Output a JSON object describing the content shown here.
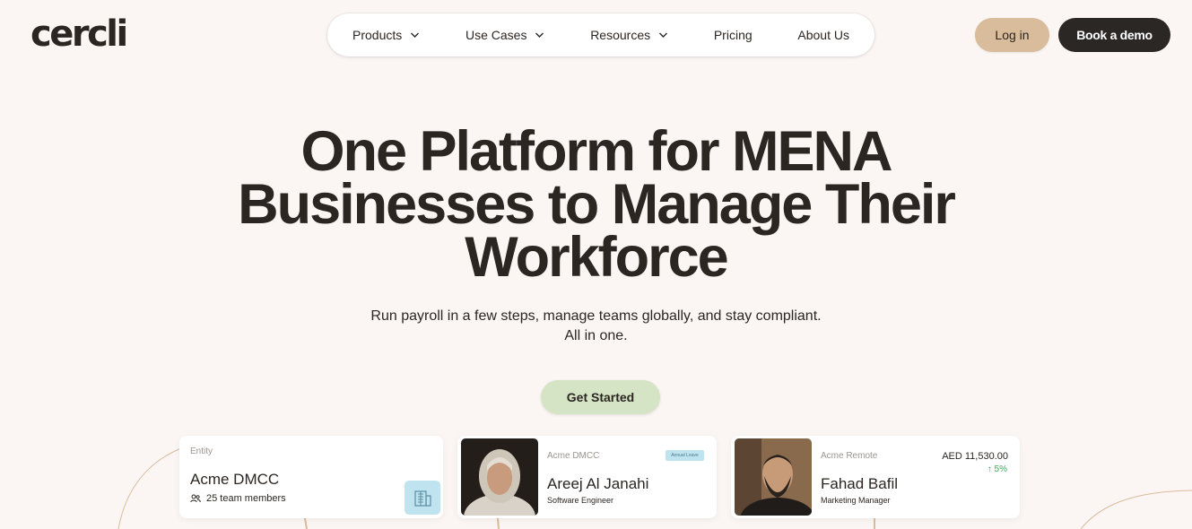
{
  "logo": "cercli",
  "nav": {
    "items": [
      {
        "label": "Products",
        "has_dropdown": true
      },
      {
        "label": "Use Cases",
        "has_dropdown": true
      },
      {
        "label": "Resources",
        "has_dropdown": true
      },
      {
        "label": "Pricing",
        "has_dropdown": false
      },
      {
        "label": "About Us",
        "has_dropdown": false
      }
    ],
    "login_label": "Log in",
    "demo_label": "Book a demo"
  },
  "hero": {
    "title_lines": [
      "One Platform for MENA",
      "Businesses to Manage Their",
      "Workforce"
    ],
    "subtitle_lines": [
      "Run payroll in a few steps, manage teams globally, and stay compliant.",
      "All in one."
    ],
    "cta_label": "Get Started"
  },
  "cards": {
    "entity": {
      "small_label": "Entity",
      "name": "Acme DMCC",
      "members": "25 team members",
      "icon": "building-icon"
    },
    "employee1": {
      "company": "Acme DMCC",
      "tag": "Annual Leave",
      "name": "Areej Al Janahi",
      "role": "Software Engineer"
    },
    "employee2": {
      "company": "Acme Remote",
      "amount": "AED 11,530.00",
      "change": "5%",
      "name": "Fahad Bafil",
      "role": "Marketing Manager"
    }
  },
  "colors": {
    "background": "#fbf6f3",
    "text": "#2b2622",
    "login_button": "#d9bc9c",
    "demo_button": "#2b2725",
    "cta_button": "#d4e4c4",
    "accent_blue": "#bfe3ef",
    "positive": "#3aa65a"
  }
}
